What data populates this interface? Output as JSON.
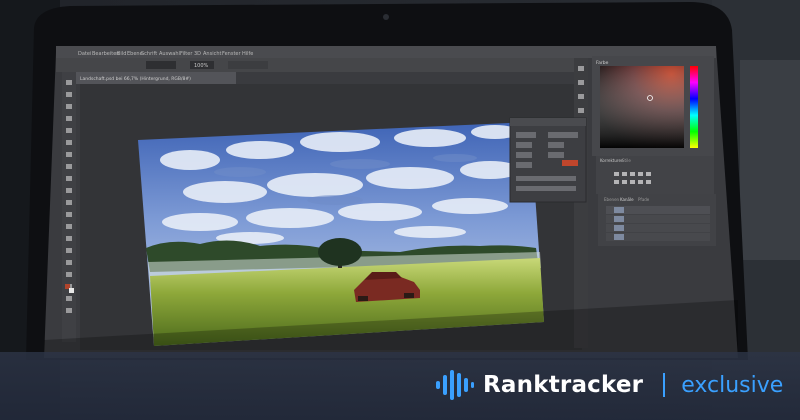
{
  "banner": {
    "brand_name": "Ranktracker",
    "tag": "exclusive",
    "brand_color": "#ffffff",
    "tag_color": "#3aa0ff"
  },
  "screen": {
    "menu_items": [
      "Datei",
      "Bearbeiten",
      "Bild",
      "Ebene",
      "Schrift",
      "Auswahl",
      "Filter",
      "3D",
      "Ansicht",
      "Fenster",
      "Hilfe"
    ],
    "document_tab": "Landschaft.psd bei 66,7% (Hintergrund, RGB/8#)",
    "options_bar_zoom": "100%",
    "panel_tabs": [
      "Farbe",
      "Korrekturen",
      "Stile",
      "Ebenen",
      "Kanäle",
      "Pfade"
    ]
  }
}
